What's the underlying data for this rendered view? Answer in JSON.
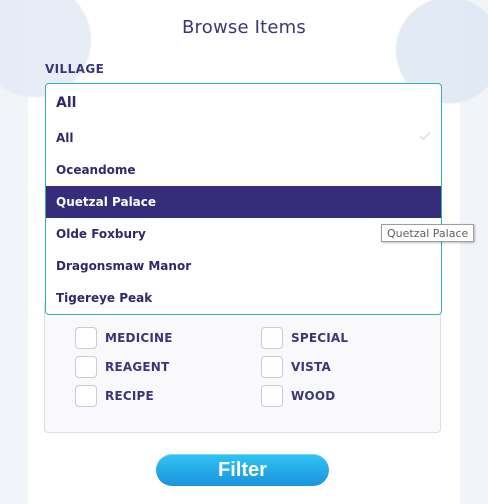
{
  "page": {
    "title": "Browse Items"
  },
  "village": {
    "label": "VILLAGE",
    "selected_value": "All",
    "options": [
      "All",
      "Oceandome",
      "Quetzal Palace",
      "Olde Foxbury",
      "Dragonsmaw Manor",
      "Tigereye Peak"
    ],
    "highlighted_option": "Quetzal Palace",
    "checked_option": "All"
  },
  "tooltip": {
    "text": "Quetzal Palace"
  },
  "categories": {
    "left": [
      "MEDICINE",
      "REAGENT",
      "RECIPE"
    ],
    "right": [
      "SPECIAL",
      "VISTA",
      "WOOD"
    ]
  },
  "filter_button": {
    "label": "Filter"
  },
  "colors": {
    "primary_text": "#3b3777",
    "selected_bg": "#352c7b",
    "focus_border": "#38aeb7",
    "button_start": "#30c4f4",
    "button_end": "#1a93dd"
  }
}
